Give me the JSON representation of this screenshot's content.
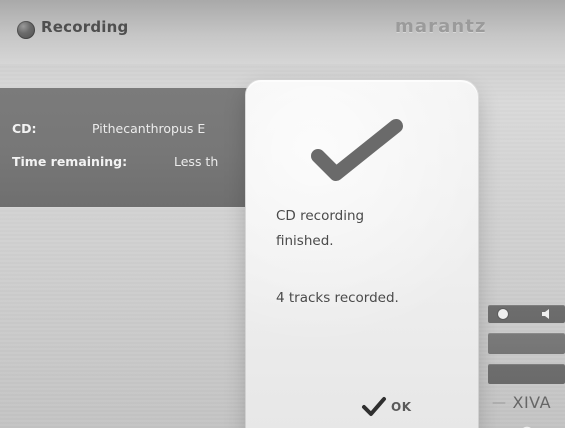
{
  "header": {
    "title": "Recording",
    "brand": "marantz"
  },
  "info": {
    "cd_label": "CD:",
    "cd_value": "Pithecanthropus E",
    "time_label": "Time remaining:",
    "time_value": "Less th"
  },
  "dialog": {
    "message_line1": "CD recording",
    "message_line2": "finished.",
    "message_line3": "4 tracks recorded.",
    "ok_label": "OK"
  },
  "brand_right": {
    "logo_text": "XIVA",
    "logo_prefix": "—"
  }
}
